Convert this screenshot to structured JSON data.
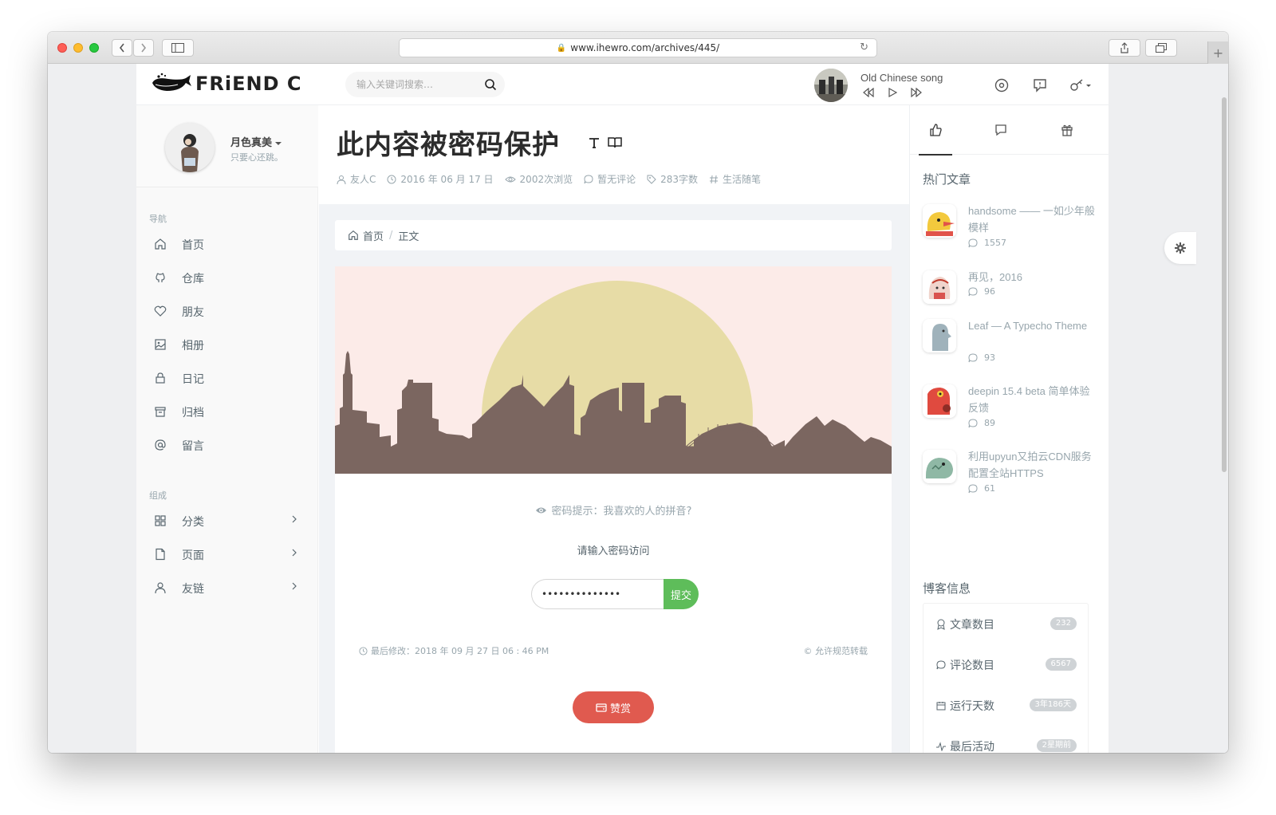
{
  "browser": {
    "url": "www.ihewro.com/archives/445/"
  },
  "header": {
    "logo_text": "FRiEND C",
    "search_placeholder": "输入关键词搜索…",
    "song_title": "Old Chinese song"
  },
  "profile": {
    "name": "月色真美",
    "motto": "只要心还跳。"
  },
  "sidebar": {
    "nav_label": "导航",
    "nav": [
      {
        "label": "首页",
        "icon": "home-icon"
      },
      {
        "label": "仓库",
        "icon": "github-icon"
      },
      {
        "label": "朋友",
        "icon": "heart-icon"
      },
      {
        "label": "相册",
        "icon": "image-icon"
      },
      {
        "label": "日记",
        "icon": "lock-icon"
      },
      {
        "label": "归档",
        "icon": "archive-icon"
      },
      {
        "label": "留言",
        "icon": "at-icon"
      }
    ],
    "group_label": "组成",
    "groups": [
      {
        "label": "分类",
        "icon": "grid-icon"
      },
      {
        "label": "页面",
        "icon": "file-icon"
      },
      {
        "label": "友链",
        "icon": "user-icon"
      }
    ]
  },
  "post": {
    "title": "此内容被密码保护",
    "meta": {
      "author": "友人C",
      "date": "2016 年 06 月 17 日",
      "views": "2002次浏览",
      "comments": "暂无评论",
      "words": "283字数",
      "category": "生活随笔"
    },
    "breadcrumb": {
      "home": "首页",
      "current": "正文"
    },
    "password_hint": "密码提示：我喜欢的人的拼音?",
    "prompt": "请输入密码访问",
    "password_value": "••••••••••••••",
    "submit_label": "提交",
    "last_modified": "最后修改：2018 年 09 月 27 日 06 : 46 PM",
    "license": "© 允许规范转载",
    "reward_label": "赞赏"
  },
  "right_sidebar": {
    "hot_title": "热门文章",
    "hot_posts": [
      {
        "title": "handsome —— 一如少年般模样",
        "comments": "1557"
      },
      {
        "title": "再见，2016",
        "comments": "96"
      },
      {
        "title": "Leaf — A Typecho Theme",
        "comments": "93"
      },
      {
        "title": "deepin 15.4 beta 简单体验反馈",
        "comments": "89"
      },
      {
        "title": "利用upyun又拍云CDN服务配置全站HTTPS",
        "comments": "61"
      }
    ],
    "info_title": "博客信息",
    "info": [
      {
        "label": "文章数目",
        "value": "232"
      },
      {
        "label": "评论数目",
        "value": "6567"
      },
      {
        "label": "运行天数",
        "value": "3年186天"
      },
      {
        "label": "最后活动",
        "value": "2星期前"
      }
    ]
  },
  "colors": {
    "accent_green": "#5ebd5a",
    "reward_red": "#e05a4f",
    "banner_bg": "#fcebe8",
    "sun": "#e7dca6",
    "skyline": "#7b6660"
  }
}
